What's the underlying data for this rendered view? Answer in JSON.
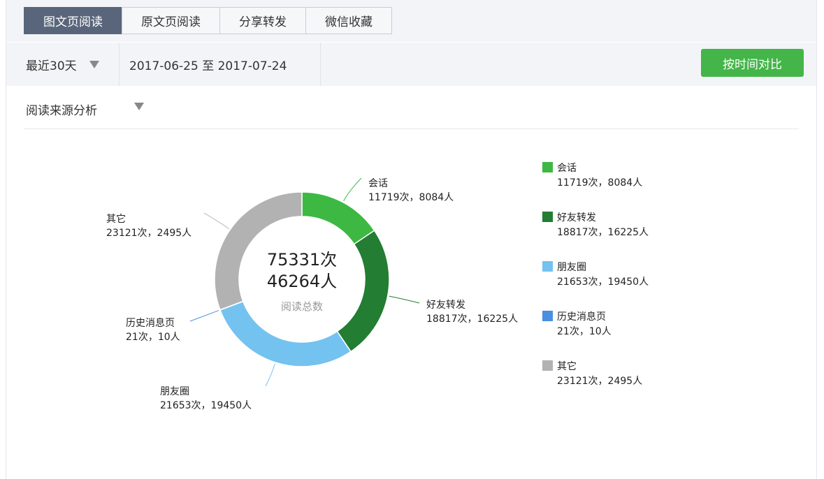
{
  "tabs": [
    {
      "label": "图文页阅读",
      "active": true
    },
    {
      "label": "原文页阅读",
      "active": false
    },
    {
      "label": "分享转发",
      "active": false
    },
    {
      "label": "微信收藏",
      "active": false
    }
  ],
  "filter": {
    "period": "最近30天",
    "date_range": "2017-06-25 至 2017-07-24",
    "compare_button": "按时间对比"
  },
  "analysis_selector": "阅读来源分析",
  "colors": {
    "accent_green": "#44b549",
    "tab_active": "#59657a"
  },
  "chart_data": {
    "type": "pie",
    "donut": true,
    "center": {
      "total_reads": "75331次",
      "total_people": "46264人",
      "caption": "阅读总数"
    },
    "series": [
      {
        "name": "会话",
        "reads": 11719,
        "people": 8084,
        "value_text": "11719次，8084人",
        "color": "#3db843"
      },
      {
        "name": "好友转发",
        "reads": 18817,
        "people": 16225,
        "value_text": "18817次，16225人",
        "color": "#237d32"
      },
      {
        "name": "朋友圈",
        "reads": 21653,
        "people": 19450,
        "value_text": "21653次，19450人",
        "color": "#74c2f0"
      },
      {
        "name": "历史消息页",
        "reads": 21,
        "people": 10,
        "value_text": "21次，10人",
        "color": "#4a8fe0"
      },
      {
        "name": "其它",
        "reads": 23121,
        "people": 2495,
        "value_text": "23121次，2495人",
        "color": "#b2b2b2"
      }
    ],
    "legend_position": "right"
  }
}
